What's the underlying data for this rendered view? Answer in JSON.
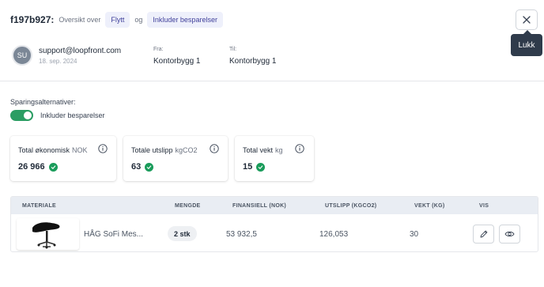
{
  "header": {
    "record_id": "f197b927:",
    "overview_label": "Oversikt over",
    "chip_move": "Flytt",
    "conjunction": "og",
    "chip_savings": "Inkluder besparelser",
    "close_icon": "close-icon",
    "close_tooltip": "Lukk"
  },
  "user": {
    "initials": "SU",
    "email": "support@loopfront.com",
    "date": "18. sep. 2024"
  },
  "move": {
    "from_label": "Fra:",
    "from_value": "Kontorbygg 1",
    "to_label": "Til:",
    "to_value": "Kontorbygg 1"
  },
  "savings": {
    "label": "Sparingsalternativer:",
    "toggle_on": true,
    "toggle_label": "Inkluder besparelser"
  },
  "cards": [
    {
      "title": "Total økonomisk",
      "unit": "NOK",
      "value": "26 966"
    },
    {
      "title": "Totale utslipp",
      "unit": "kgCO2",
      "value": "63"
    },
    {
      "title": "Total vekt",
      "unit": "kg",
      "value": "15"
    }
  ],
  "table": {
    "headers": [
      "MATERIALE",
      "MENGDE",
      "FINANSIELL (NOK)",
      "UTSLIPP (KGCO2)",
      "VEKT (KG)",
      "VIS"
    ],
    "rows": [
      {
        "image_icon": "office-chair-image",
        "name": "HÅG SoFi Mes...",
        "quantity": "2 stk",
        "financial": "53 932,5",
        "emission": "126,053",
        "weight": "30",
        "actions": [
          "edit-icon",
          "view-icon"
        ]
      }
    ]
  },
  "colors": {
    "accent_green": "#2b9d63",
    "chip_bg": "#eef0fb",
    "chip_text": "#3f3f9a",
    "tooltip_bg": "#2f3b4b",
    "table_header_bg": "#e9edf3"
  }
}
